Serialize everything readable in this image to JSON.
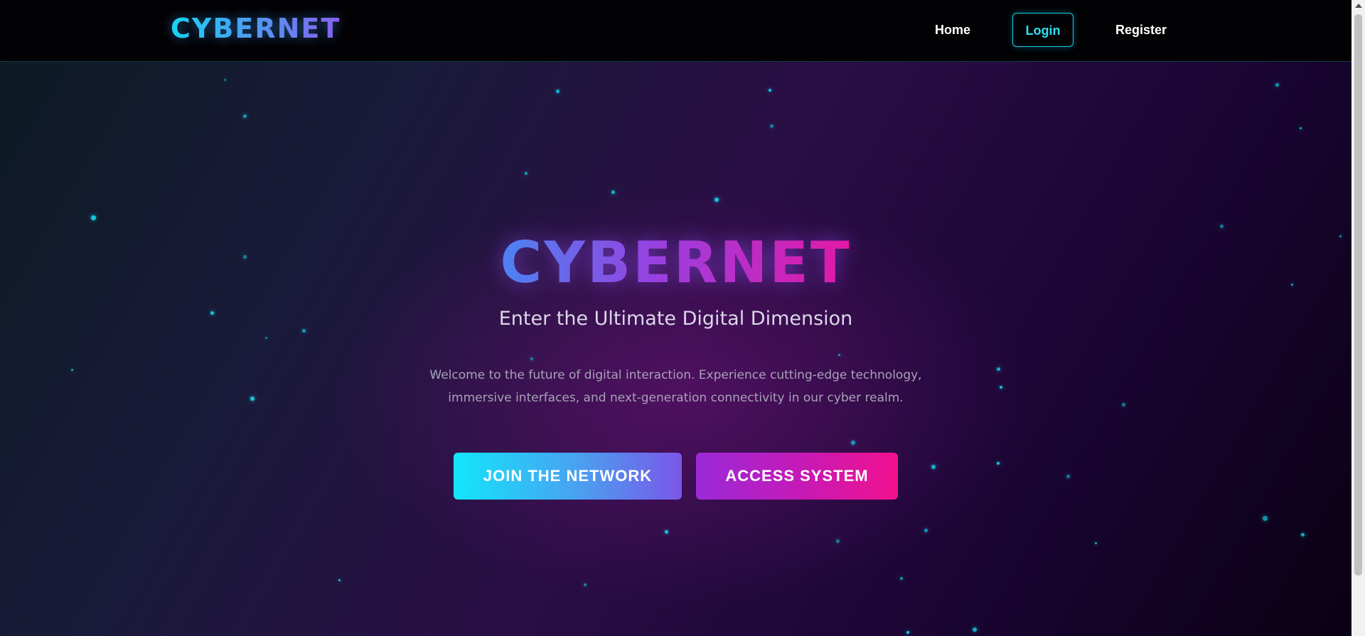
{
  "navbar": {
    "logo": "CYBERNET",
    "links": {
      "home": "Home",
      "login": "Login",
      "register": "Register"
    }
  },
  "hero": {
    "title": "CYBERNET",
    "subtitle": "Enter the Ultimate Digital Dimension",
    "description": "Welcome to the future of digital interaction. Experience cutting-edge technology, immersive interfaces, and next-generation connectivity in our cyber realm.",
    "buttons": {
      "join": "JOIN THE NETWORK",
      "access": "ACCESS SYSTEM"
    }
  },
  "colors": {
    "accent_cyan": "#16d8ef",
    "accent_magenta": "#f2118e",
    "accent_purple": "#9a2ad8"
  }
}
